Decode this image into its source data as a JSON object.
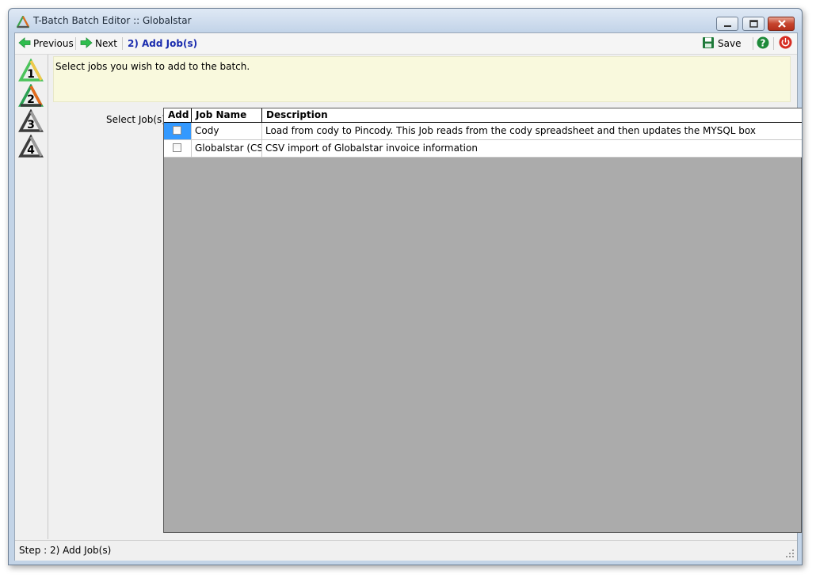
{
  "window": {
    "title": "T-Batch Batch Editor :: Globalstar"
  },
  "toolbar": {
    "previous_label": "Previous",
    "next_label": "Next",
    "step_title": "2) Add Job(s)",
    "save_label": "Save"
  },
  "steps": [
    {
      "number": "1",
      "state": "done"
    },
    {
      "number": "2",
      "state": "current"
    },
    {
      "number": "3",
      "state": "pending"
    },
    {
      "number": "4",
      "state": "pending"
    }
  ],
  "info": {
    "text": "Select jobs you wish to add to the batch."
  },
  "form": {
    "select_jobs_label": "Select Job(s):"
  },
  "grid": {
    "columns": [
      "Add",
      "Job Name",
      "Description"
    ],
    "rows": [
      {
        "add": false,
        "job_name": "Cody",
        "description": "Load from cody to Pincody.  This Job reads from the cody spreadsheet and then updates the MYSQL box"
      },
      {
        "add": false,
        "job_name": "Globalstar (CSV)",
        "description": "CSV import of Globalstar invoice information"
      }
    ]
  },
  "status": {
    "text": "Step : 2) Add Job(s)"
  },
  "colors": {
    "accent_step_text": "#1a2cae",
    "info_bg": "#f9f9dd",
    "grid_empty_bg": "#ababab",
    "selection": "#3399ff"
  }
}
